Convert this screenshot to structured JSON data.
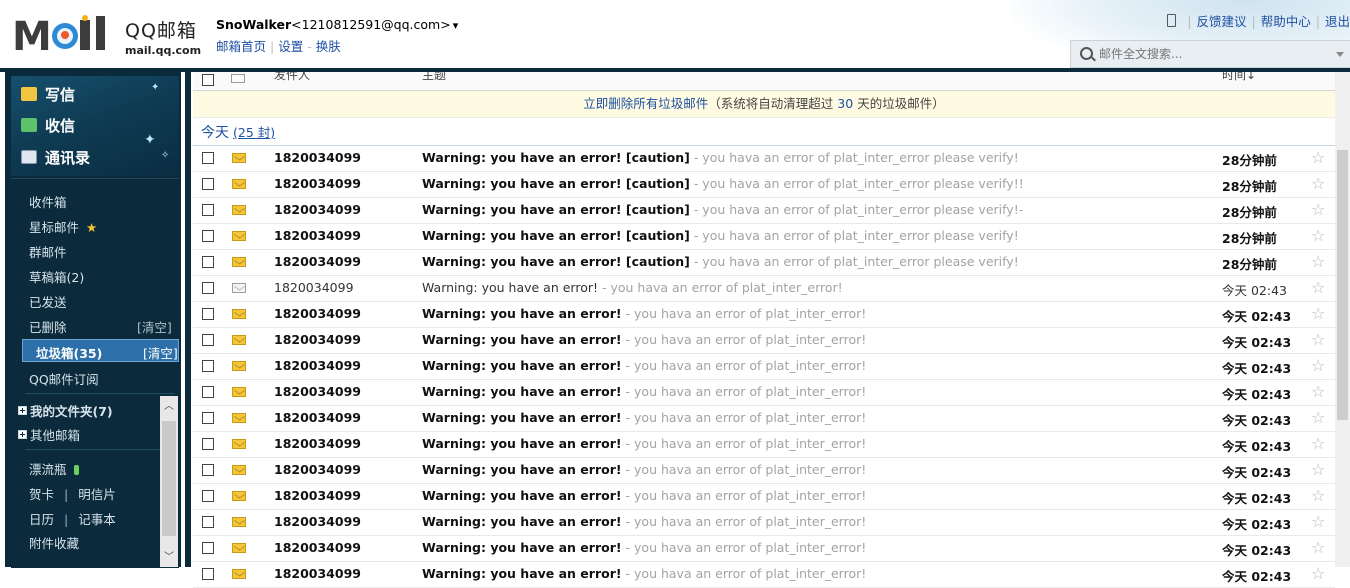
{
  "header": {
    "logo_text": "MOil",
    "brand_cn": "QQ邮箱",
    "brand_domain": "mail.qq.com",
    "user_name": "SnoWalker",
    "user_email": "<1210812591@qq.com>",
    "dropdown_glyph": "▾",
    "links": [
      "邮箱首页",
      "设置",
      "换肤"
    ],
    "top_links": [
      "反馈建议",
      "帮助中心",
      "退出"
    ],
    "search_placeholder": "邮件全文搜索..."
  },
  "sidebar": {
    "compose": "写信",
    "receive": "收信",
    "contacts": "通讯录",
    "folders": {
      "inbox": "收件箱",
      "starred": "星标邮件",
      "starred_glyph": "★",
      "group": "群邮件",
      "drafts": "草稿箱(2)",
      "sent": "已发送",
      "deleted": "已删除",
      "deleted_clear": "[清空]",
      "spam": "垃圾箱(35)",
      "spam_clear": "[清空]",
      "subscriptions": "QQ邮件订阅",
      "my_folders": "我的文件夹(7)",
      "other_mailboxes": "其他邮箱",
      "bottle": "漂流瓶",
      "card": "贺卡",
      "postcard": "明信片",
      "calendar": "日历",
      "notes": "记事本",
      "attachments": "附件收藏"
    },
    "separator": "|"
  },
  "list": {
    "columns": [
      "发件人",
      "主题",
      "时间↓"
    ],
    "spam_notice": {
      "link": "立即删除所有垃圾邮件",
      "prefix": "（系统将自动清理超过",
      "days": "30",
      "suffix": "天的垃圾邮件）"
    },
    "group_title": "今天",
    "group_count": "(25 封)",
    "star_glyph": "☆",
    "rows": [
      {
        "read": false,
        "sender": "1820034099",
        "subject": "Warning: you have an error! [caution]",
        "preview": " - you hava an error of plat_inter_error please verify!",
        "time": "28分钟前"
      },
      {
        "read": false,
        "sender": "1820034099",
        "subject": "Warning: you have an error! [caution]",
        "preview": " - you hava an error of plat_inter_error please verify!!",
        "time": "28分钟前"
      },
      {
        "read": false,
        "sender": "1820034099",
        "subject": "Warning: you have an error! [caution]",
        "preview": " - you hava an error of plat_inter_error please verify!-",
        "time": "28分钟前"
      },
      {
        "read": false,
        "sender": "1820034099",
        "subject": "Warning: you have an error! [caution]",
        "preview": " - you hava an error of plat_inter_error please verify!",
        "time": "28分钟前"
      },
      {
        "read": false,
        "sender": "1820034099",
        "subject": "Warning: you have an error! [caution]",
        "preview": " - you hava an error of plat_inter_error please verify!",
        "time": "28分钟前"
      },
      {
        "read": true,
        "sender": "1820034099",
        "subject": "Warning: you have an error!",
        "preview": " - you hava an error of plat_inter_error!",
        "time": "今天 02:43"
      },
      {
        "read": false,
        "sender": "1820034099",
        "subject": "Warning: you have an error!",
        "preview": " - you hava an error of plat_inter_error!",
        "time": "今天 02:43"
      },
      {
        "read": false,
        "sender": "1820034099",
        "subject": "Warning: you have an error!",
        "preview": " - you hava an error of plat_inter_error!",
        "time": "今天 02:43"
      },
      {
        "read": false,
        "sender": "1820034099",
        "subject": "Warning: you have an error!",
        "preview": " - you hava an error of plat_inter_error!",
        "time": "今天 02:43"
      },
      {
        "read": false,
        "sender": "1820034099",
        "subject": "Warning: you have an error!",
        "preview": " - you hava an error of plat_inter_error!",
        "time": "今天 02:43"
      },
      {
        "read": false,
        "sender": "1820034099",
        "subject": "Warning: you have an error!",
        "preview": " - you hava an error of plat_inter_error!",
        "time": "今天 02:43"
      },
      {
        "read": false,
        "sender": "1820034099",
        "subject": "Warning: you have an error!",
        "preview": " - you hava an error of plat_inter_error!",
        "time": "今天 02:43"
      },
      {
        "read": false,
        "sender": "1820034099",
        "subject": "Warning: you have an error!",
        "preview": " - you hava an error of plat_inter_error!",
        "time": "今天 02:43"
      },
      {
        "read": false,
        "sender": "1820034099",
        "subject": "Warning: you have an error!",
        "preview": " - you hava an error of plat_inter_error!",
        "time": "今天 02:43"
      },
      {
        "read": false,
        "sender": "1820034099",
        "subject": "Warning: you have an error!",
        "preview": " - you hava an error of plat_inter_error!",
        "time": "今天 02:43"
      },
      {
        "read": false,
        "sender": "1820034099",
        "subject": "Warning: you have an error!",
        "preview": " - you hava an error of plat_inter_error!",
        "time": "今天 02:43"
      },
      {
        "read": false,
        "sender": "1820034099",
        "subject": "Warning: you have an error!",
        "preview": " - you hava an error of plat_inter_error!",
        "time": "今天 02:43"
      }
    ]
  },
  "colors": {
    "sidebar_bg": "#0b2a3c",
    "link": "#1e50a2",
    "spam_selected": "#2d6fa8",
    "unread_envelope": "#f3c53a"
  }
}
